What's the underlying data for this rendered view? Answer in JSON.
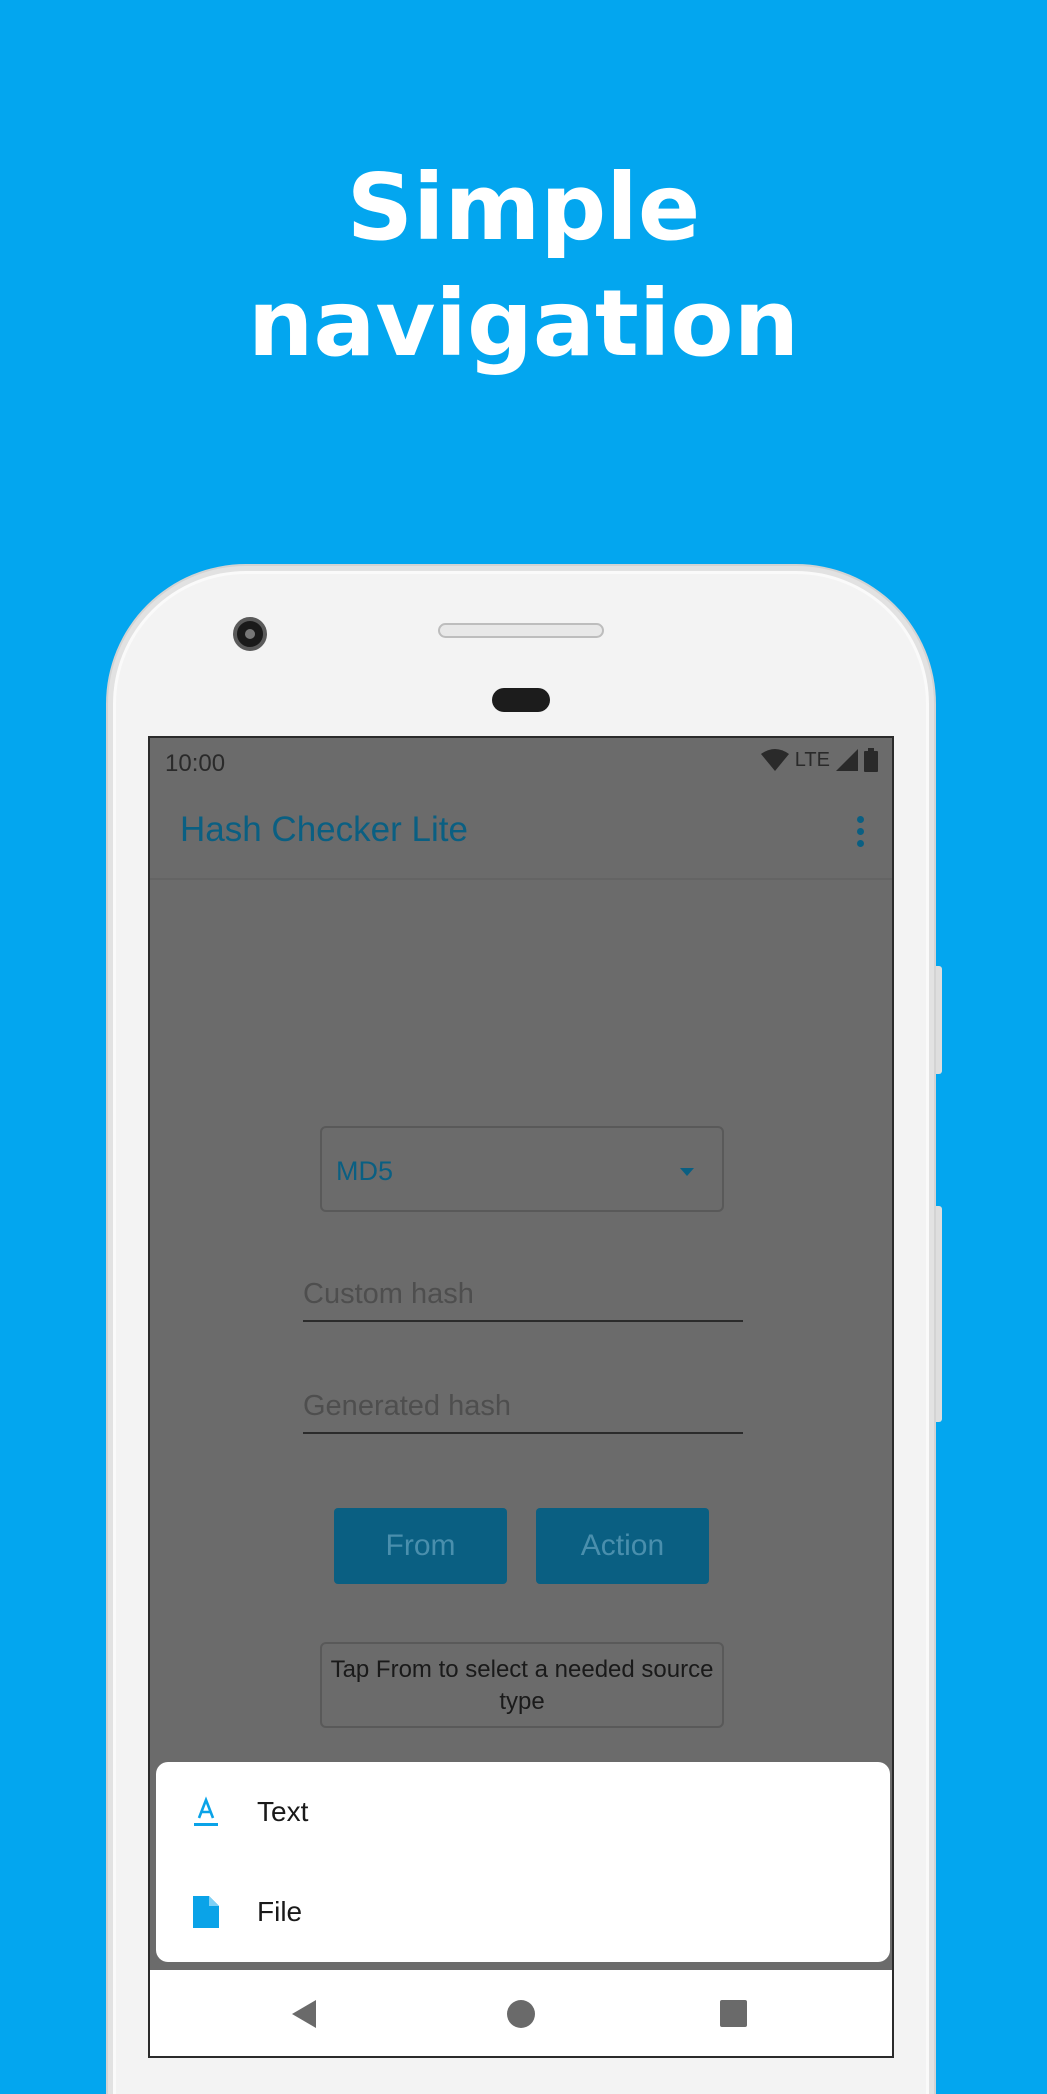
{
  "headline": {
    "line1": "Simple",
    "line2": "navigation"
  },
  "status_bar": {
    "time": "10:00",
    "network": "LTE"
  },
  "app_bar": {
    "title": "Hash Checker Lite"
  },
  "hash_select": {
    "value": "MD5"
  },
  "fields": {
    "custom_hash_placeholder": "Custom hash",
    "generated_hash_placeholder": "Generated hash"
  },
  "buttons": {
    "from": "From",
    "action": "Action"
  },
  "hint": "Tap From to select a needed source type",
  "sheet": {
    "items": [
      {
        "label": "Text",
        "icon": "text-format-icon"
      },
      {
        "label": "File",
        "icon": "file-icon"
      }
    ]
  },
  "colors": {
    "background": "#03a6ef",
    "accent": "#0a5f82",
    "sheet_icon": "#0aa3e8"
  }
}
